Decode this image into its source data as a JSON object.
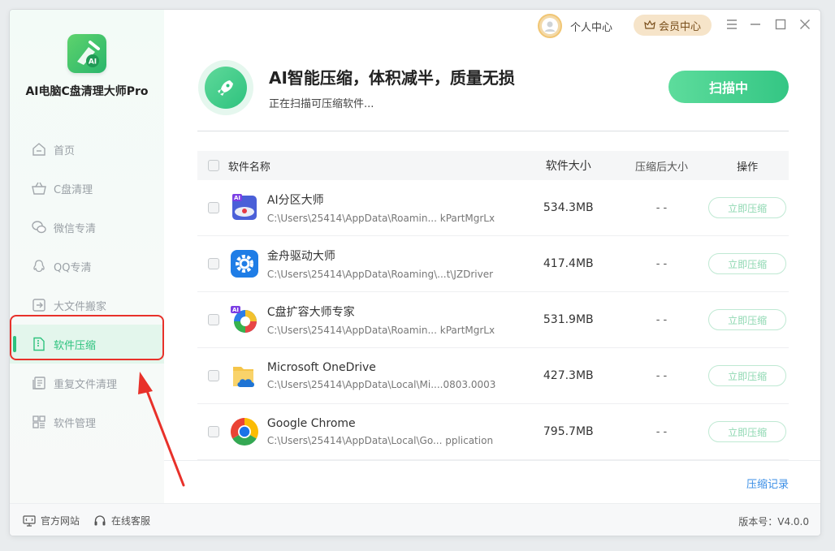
{
  "app": {
    "name": "AI电脑C盘清理大师Pro"
  },
  "topbar": {
    "user_center": "个人中心",
    "vip_center": "会员中心"
  },
  "sidebar": {
    "items": [
      {
        "label": "首页",
        "icon": "home-icon"
      },
      {
        "label": "C盘清理",
        "icon": "basket-icon"
      },
      {
        "label": "微信专清",
        "icon": "wechat-icon"
      },
      {
        "label": "QQ专清",
        "icon": "qq-icon"
      },
      {
        "label": "大文件搬家",
        "icon": "move-file-icon"
      },
      {
        "label": "软件压缩",
        "icon": "zip-file-icon",
        "active": true
      },
      {
        "label": "重复文件清理",
        "icon": "duplicate-file-icon"
      },
      {
        "label": "软件管理",
        "icon": "apps-grid-icon"
      }
    ]
  },
  "header": {
    "title": "AI智能压缩，体积减半，质量无损",
    "subtitle": "正在扫描可压缩软件...",
    "scan_button": "扫描中"
  },
  "table": {
    "columns": {
      "name": "软件名称",
      "size": "软件大小",
      "after": "压缩后大小",
      "action": "操作"
    },
    "action_label": "立即压缩",
    "rows": [
      {
        "name": "AI分区大师",
        "path": "C:\\Users\\25414\\AppData\\Roamin... kPartMgrLx",
        "size": "534.3MB",
        "after": "- -",
        "icon": "partition-tool-icon"
      },
      {
        "name": "金舟驱动大师",
        "path": "C:\\Users\\25414\\AppData\\Roaming\\...t\\JZDriver",
        "size": "417.4MB",
        "after": "- -",
        "icon": "driver-gear-icon"
      },
      {
        "name": "C盘扩容大师专家",
        "path": "C:\\Users\\25414\\AppData\\Roamin... kPartMgrLx",
        "size": "531.9MB",
        "after": "- -",
        "icon": "disk-expand-icon"
      },
      {
        "name": "Microsoft OneDrive",
        "path": "C:\\Users\\25414\\AppData\\Local\\Mi....0803.0003",
        "size": "427.3MB",
        "after": "- -",
        "icon": "onedrive-icon"
      },
      {
        "name": "Google Chrome",
        "path": "C:\\Users\\25414\\AppData\\Local\\Go... pplication",
        "size": "795.7MB",
        "after": "- -",
        "icon": "chrome-icon"
      }
    ]
  },
  "record_link": "压缩记录",
  "footer": {
    "website": "官方网站",
    "support": "在线客服",
    "version": "版本号：V4.0.0"
  },
  "colors": {
    "accent": "#2ec27e",
    "annotation": "#e8312a",
    "link": "#3a8ee6"
  }
}
